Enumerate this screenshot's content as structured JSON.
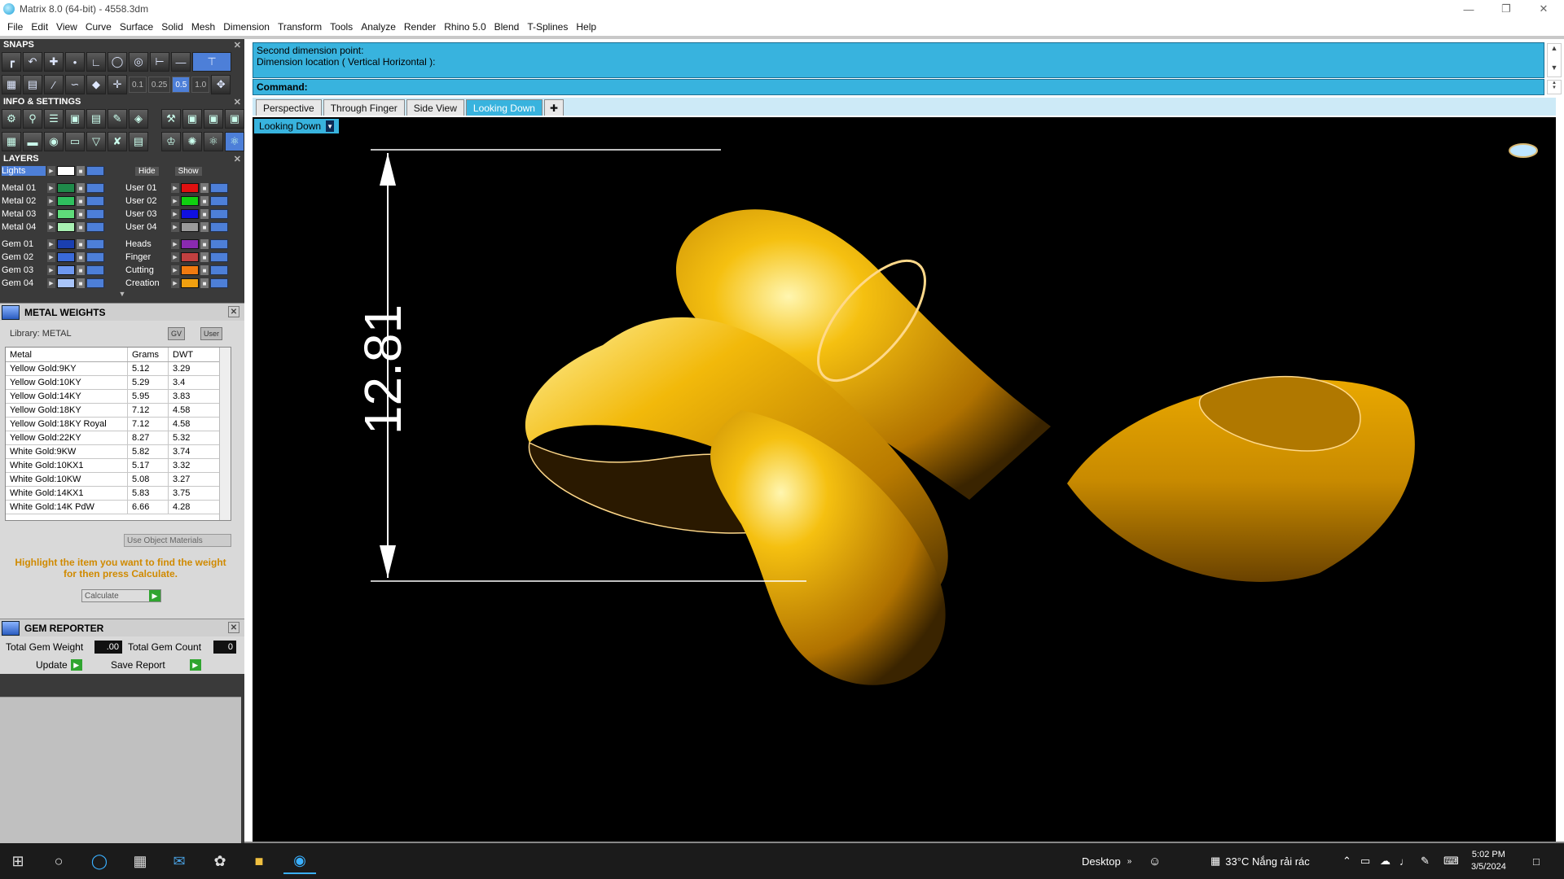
{
  "window": {
    "title": "Matrix 8.0 (64-bit) - 4558.3dm"
  },
  "menu": [
    "File",
    "Edit",
    "View",
    "Curve",
    "Surface",
    "Solid",
    "Mesh",
    "Dimension",
    "Transform",
    "Tools",
    "Analyze",
    "Render",
    "Rhino 5.0",
    "Blend",
    "T-Splines",
    "Help"
  ],
  "panels": {
    "snaps": {
      "title": "SNAPS",
      "numbers": [
        "0.1",
        "0.25",
        "0.5",
        "1.0"
      ]
    },
    "info": {
      "title": "INFO & SETTINGS"
    },
    "layers": {
      "title": "LAYERS",
      "hide_label": "Hide",
      "show_label": "Show",
      "left": [
        {
          "name": "Lights",
          "color": "#ffffff"
        },
        {
          "name": "Metal 01",
          "color": "#1f8a4a"
        },
        {
          "name": "Metal 02",
          "color": "#2fbf5e"
        },
        {
          "name": "Metal 03",
          "color": "#5fdc7a"
        },
        {
          "name": "Metal 04",
          "color": "#a8f0b2"
        },
        {
          "name": "Gem 01",
          "color": "#1a3fb0"
        },
        {
          "name": "Gem 02",
          "color": "#3a6ad8"
        },
        {
          "name": "Gem 03",
          "color": "#6e98f0"
        },
        {
          "name": "Gem 04",
          "color": "#a8c4f8"
        }
      ],
      "right": [
        {
          "name": "",
          "color": ""
        },
        {
          "name": "User 01",
          "color": "#e01010"
        },
        {
          "name": "User 02",
          "color": "#10d010"
        },
        {
          "name": "User 03",
          "color": "#1010e0"
        },
        {
          "name": "User 04",
          "color": "#9a9a9a"
        },
        {
          "name": "Heads",
          "color": "#8a2ab0"
        },
        {
          "name": "Finger",
          "color": "#c04040"
        },
        {
          "name": "Cutting",
          "color": "#f07a10"
        },
        {
          "name": "Creation",
          "color": "#f0a010"
        }
      ]
    },
    "metal_weights": {
      "title": "METAL WEIGHTS",
      "library": "Library: METAL",
      "gv": "GV",
      "user": "User",
      "columns": [
        "Metal",
        "Grams",
        "DWT"
      ],
      "rows": [
        [
          "Yellow Gold:9KY",
          "5.12",
          "3.29"
        ],
        [
          "Yellow Gold:10KY",
          "5.29",
          "3.4"
        ],
        [
          "Yellow Gold:14KY",
          "5.95",
          "3.83"
        ],
        [
          "Yellow Gold:18KY",
          "7.12",
          "4.58"
        ],
        [
          "Yellow Gold:18KY Royal",
          "7.12",
          "4.58"
        ],
        [
          "Yellow Gold:22KY",
          "8.27",
          "5.32"
        ],
        [
          "White Gold:9KW",
          "5.82",
          "3.74"
        ],
        [
          "White Gold:10KX1",
          "5.17",
          "3.32"
        ],
        [
          "White Gold:10KW",
          "5.08",
          "3.27"
        ],
        [
          "White Gold:14KX1",
          "5.83",
          "3.75"
        ],
        [
          "White Gold:14K PdW",
          "6.66",
          "4.28"
        ]
      ],
      "use_object_materials": "Use Object Materials",
      "hint": "Highlight the item you want to find the weight for then press Calculate.",
      "calculate": "Calculate"
    },
    "gem_reporter": {
      "title": "GEM REPORTER",
      "total_weight_label": "Total Gem Weight",
      "total_weight": ".00",
      "total_count_label": "Total Gem Count",
      "total_count": "0",
      "update": "Update",
      "save_report": "Save Report"
    }
  },
  "command": {
    "line1": "Second dimension point:",
    "line2": "Dimension location ( Vertical  Horizontal ):",
    "prompt": "Command:"
  },
  "tabs": [
    "Perspective",
    "Through Finger",
    "Side View",
    "Looking Down"
  ],
  "active_tab": "Looking Down",
  "viewport": {
    "label": "Looking Down",
    "dimension": "12.81"
  },
  "taskbar": {
    "desktop": "Desktop",
    "weather": "33°C  Nắng rải rác",
    "time": "5:02 PM",
    "date": "3/5/2024"
  }
}
